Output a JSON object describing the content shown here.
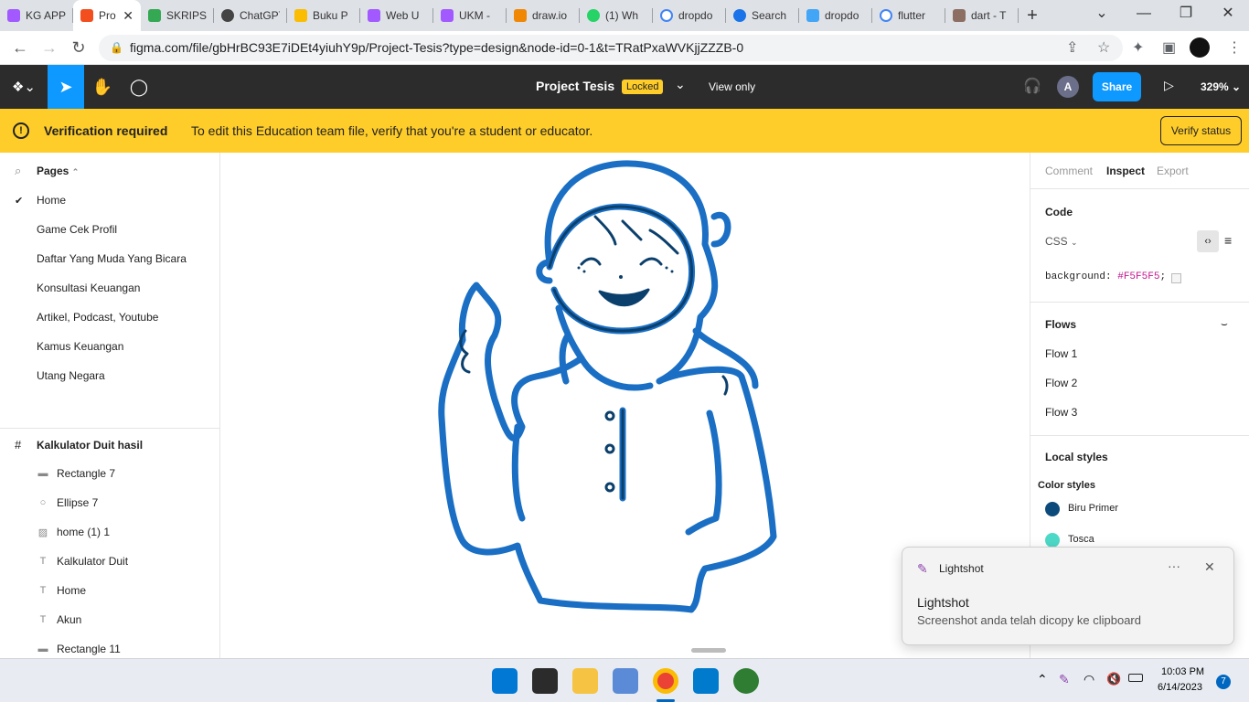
{
  "browser": {
    "tabs": [
      {
        "title": "KG APP",
        "color": "#a259ff",
        "active": false
      },
      {
        "title": "Pro",
        "color": "#f24e1e",
        "active": true
      },
      {
        "title": "SKRIPSI",
        "color": "#34a853",
        "active": false
      },
      {
        "title": "ChatGPT",
        "color": "#444444",
        "active": false
      },
      {
        "title": "Buku P",
        "color": "#fbbc04",
        "active": false
      },
      {
        "title": "Web U",
        "color": "#a259ff",
        "active": false
      },
      {
        "title": "UKM -",
        "color": "#a259ff",
        "active": false
      },
      {
        "title": "draw.io",
        "color": "#f08705",
        "active": false
      },
      {
        "title": "(1) Wh",
        "color": "#25d366",
        "active": false
      },
      {
        "title": "dropdo",
        "color": "#4285f4",
        "active": false
      },
      {
        "title": "Search",
        "color": "#1a73e8",
        "active": false
      },
      {
        "title": "dropdo",
        "color": "#42a5f5",
        "active": false
      },
      {
        "title": "flutter",
        "color": "#4285f4",
        "active": false
      },
      {
        "title": "dart - T",
        "color": "#8d6e63",
        "active": false
      }
    ],
    "new_tab": "+",
    "url": "figma.com/file/gbHrBC93E7iDEt4yiuhY9p/Project-Tesis?type=design&node-id=0-1&t=TRatPxaWVKjjZZZB-0"
  },
  "figma": {
    "file_title": "Project Tesis",
    "locked_badge": "Locked",
    "view_only": "View only",
    "avatar_letter": "A",
    "share": "Share",
    "zoom": "329%"
  },
  "banner": {
    "title": "Verification required",
    "message": "To edit this Education team file, verify that you're a student or educator.",
    "button": "Verify status"
  },
  "pages": {
    "header": "Pages",
    "items": [
      "Home",
      "Game Cek Profil",
      "Daftar Yang Muda Yang Bicara",
      "Konsultasi Keuangan",
      "Artikel, Podcast, Youtube",
      "Kamus Keuangan",
      "Utang Negara"
    ]
  },
  "layers": {
    "frame": "Kalkulator Duit hasil",
    "items": [
      {
        "name": "Rectangle 7",
        "icon": "rect"
      },
      {
        "name": "Ellipse 7",
        "icon": "ellipse"
      },
      {
        "name": "home (1) 1",
        "icon": "image"
      },
      {
        "name": "Kalkulator Duit",
        "icon": "text"
      },
      {
        "name": "Home",
        "icon": "text"
      },
      {
        "name": "Akun",
        "icon": "text"
      },
      {
        "name": "Rectangle 11",
        "icon": "rect"
      }
    ]
  },
  "inspect": {
    "tabs": [
      "Comment",
      "Inspect",
      "Export"
    ],
    "code_title": "Code",
    "lang": "CSS",
    "code_prop": "background:",
    "code_value": "#F5F5F5",
    "code_end": ";",
    "flows_title": "Flows",
    "flows": [
      "Flow 1",
      "Flow 2",
      "Flow 3"
    ],
    "local_styles": "Local styles",
    "color_styles": "Color styles",
    "colors": [
      {
        "name": "Biru Primer",
        "hex": "#0b4a7a"
      },
      {
        "name": "Tosca",
        "hex": "#4dd9c7"
      }
    ]
  },
  "toast": {
    "app": "Lightshot",
    "title": "Lightshot",
    "message": "Screenshot anda telah dicopy ke clipboard",
    "more": "···"
  },
  "taskbar": {
    "time": "10:03 PM",
    "date": "6/14/2023",
    "badge": "7"
  }
}
